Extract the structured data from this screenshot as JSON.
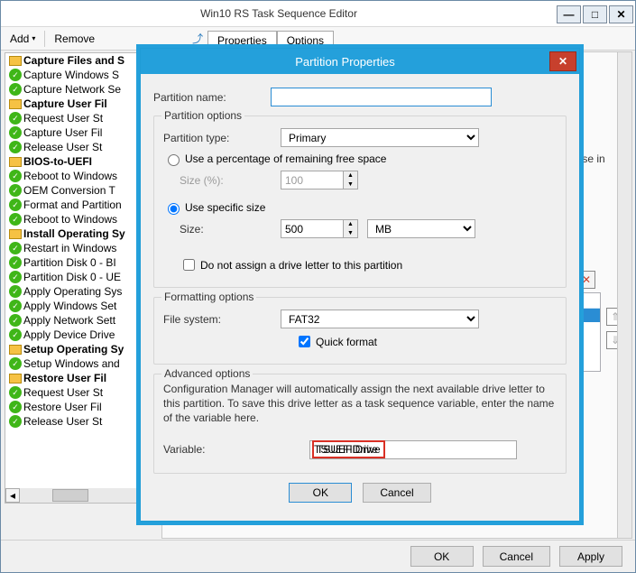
{
  "mainWindow": {
    "title": "Win10 RS Task Sequence Editor",
    "toolbar": {
      "add": "Add",
      "remove": "Remove"
    },
    "tabs": {
      "properties": "Properties",
      "options": "Options"
    },
    "rightPanel": {
      "hint": "layout to use in the"
    },
    "buttons": {
      "ok": "OK",
      "cancel": "Cancel",
      "apply": "Apply"
    }
  },
  "tree": [
    {
      "level": 1,
      "icon": "folder",
      "bold": true,
      "label": "Capture Files and S"
    },
    {
      "level": 2,
      "icon": "ok",
      "label": "Capture Windows S"
    },
    {
      "level": 2,
      "icon": "ok",
      "label": "Capture Network Se"
    },
    {
      "level": 2,
      "icon": "folder",
      "bold": true,
      "label": "Capture User Fil"
    },
    {
      "level": 3,
      "icon": "ok",
      "label": "Request User St"
    },
    {
      "level": 3,
      "icon": "ok",
      "label": "Capture User Fil"
    },
    {
      "level": 3,
      "icon": "ok",
      "label": "Release User St"
    },
    {
      "level": 1,
      "icon": "folder",
      "bold": true,
      "label": "BIOS-to-UEFI"
    },
    {
      "level": 2,
      "icon": "ok",
      "label": "Reboot to Windows"
    },
    {
      "level": 2,
      "icon": "ok",
      "label": "OEM Conversion T"
    },
    {
      "level": 2,
      "icon": "ok",
      "label": "Format and Partition"
    },
    {
      "level": 2,
      "icon": "ok",
      "label": "Reboot to Windows"
    },
    {
      "level": 1,
      "icon": "folder",
      "bold": true,
      "label": "Install Operating Sy"
    },
    {
      "level": 2,
      "icon": "ok",
      "label": "Restart in Windows"
    },
    {
      "level": 2,
      "icon": "ok",
      "label": "Partition Disk 0 - BI"
    },
    {
      "level": 2,
      "icon": "ok",
      "label": "Partition Disk 0 - UE"
    },
    {
      "level": 2,
      "icon": "ok",
      "label": "Apply Operating Sys"
    },
    {
      "level": 2,
      "icon": "ok",
      "label": "Apply Windows Set"
    },
    {
      "level": 2,
      "icon": "ok",
      "label": "Apply Network Sett"
    },
    {
      "level": 2,
      "icon": "ok",
      "label": "Apply Device Drive"
    },
    {
      "level": 1,
      "icon": "folder",
      "bold": true,
      "label": "Setup Operating Sy"
    },
    {
      "level": 2,
      "icon": "ok",
      "label": "Setup Windows and"
    },
    {
      "level": 2,
      "icon": "folder",
      "bold": true,
      "label": "Restore User Fil"
    },
    {
      "level": 3,
      "icon": "ok",
      "label": "Request User St"
    },
    {
      "level": 3,
      "icon": "ok",
      "label": "Restore User Fil"
    },
    {
      "level": 3,
      "icon": "ok",
      "label": "Release User St"
    }
  ],
  "dialog": {
    "title": "Partition Properties",
    "partitionNameLabel": "Partition name:",
    "partitionNameValue": "",
    "optionsLegend": "Partition options",
    "partitionTypeLabel": "Partition type:",
    "partitionTypeValue": "Primary",
    "radioPercent": "Use a percentage of remaining free space",
    "sizePctLabel": "Size (%):",
    "sizePctValue": "100",
    "radioSpecific": "Use specific size",
    "sizeLabel": "Size:",
    "sizeValue": "500",
    "sizeUnit": "MB",
    "noDriveLetter": "Do not assign a drive letter to this partition",
    "formattingLegend": "Formatting options",
    "fileSystemLabel": "File system:",
    "fileSystemValue": "FAT32",
    "quickFormat": "Quick format",
    "advancedLegend": "Advanced options",
    "advancedHelp": "Configuration Manager will automatically assign the next available drive letter to this partition. To save this drive letter as a task sequence variable, enter the name of the variable here.",
    "variableLabel": "Variable:",
    "variableValue": "TSUEFIDrive",
    "ok": "OK",
    "cancel": "Cancel"
  }
}
